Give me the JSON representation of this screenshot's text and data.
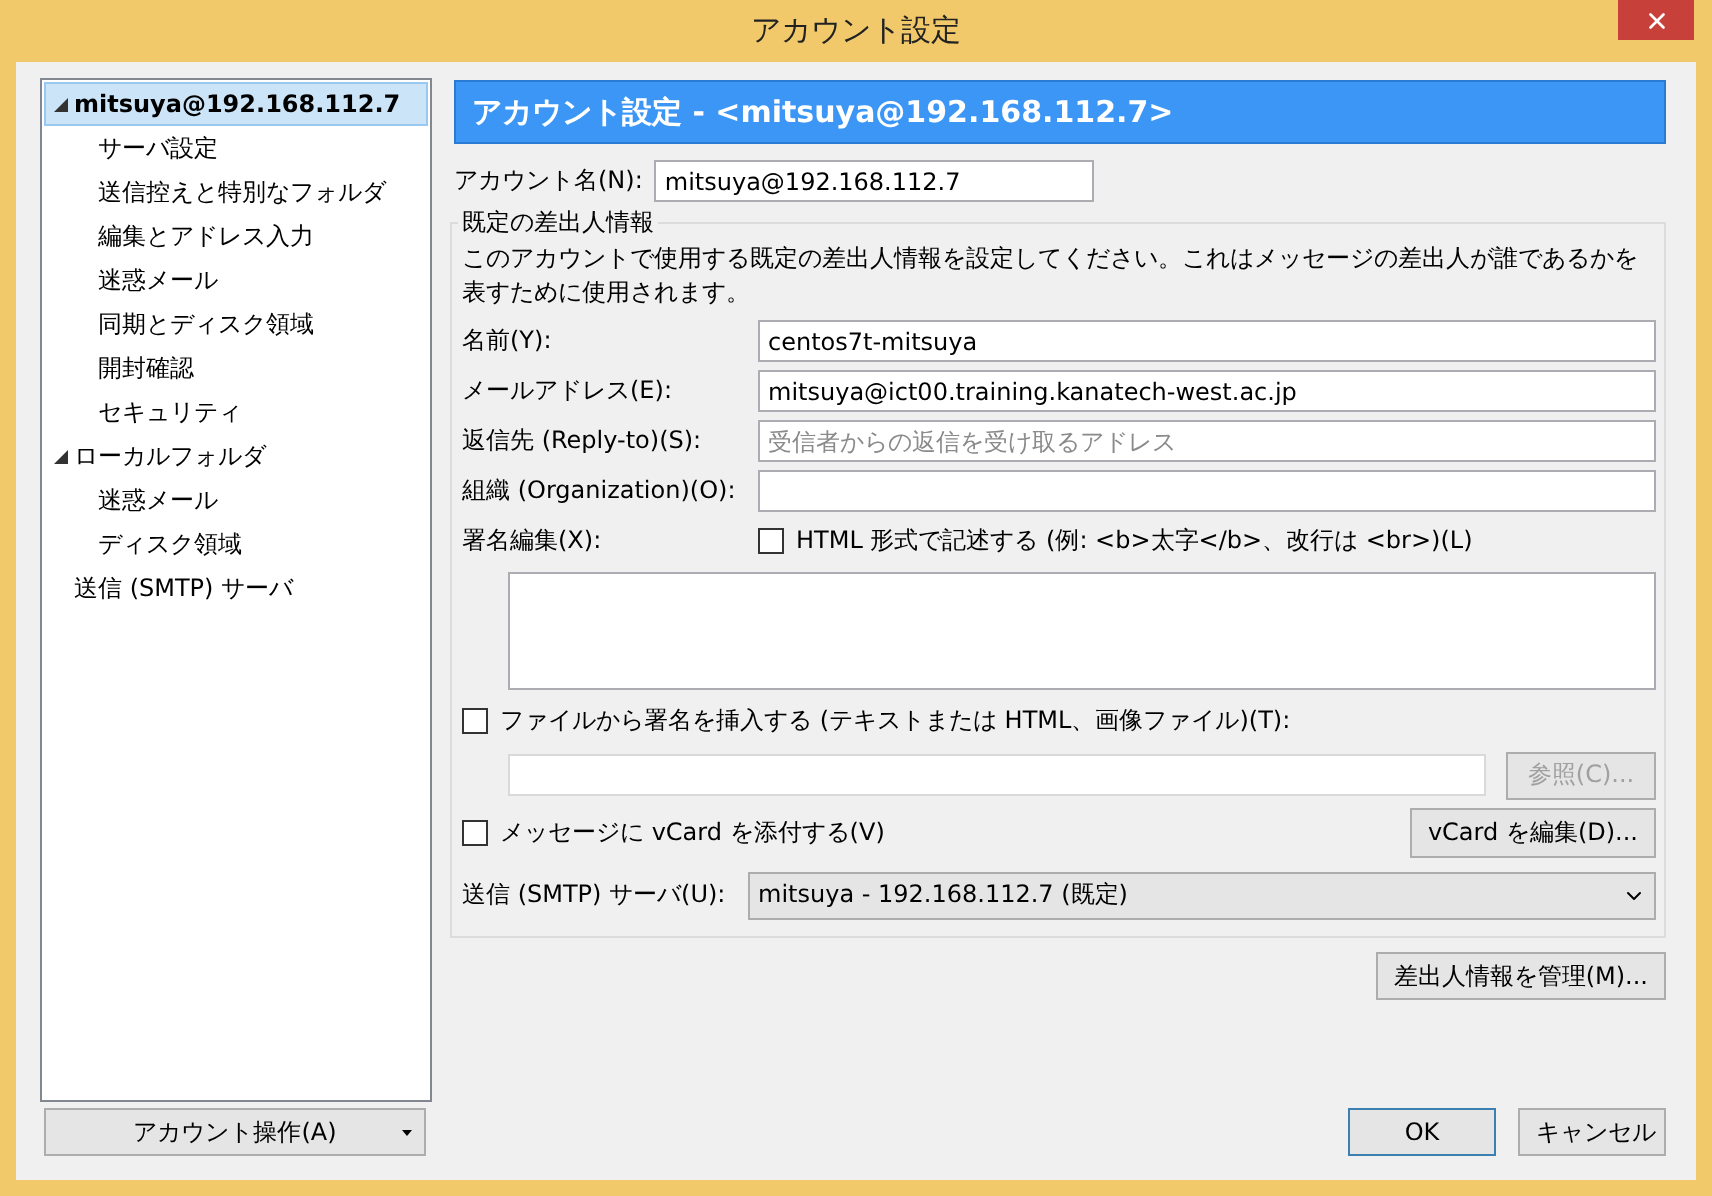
{
  "window": {
    "title": "アカウント設定"
  },
  "tree": [
    {
      "label": "mitsuya@192.168.112.7",
      "selected": true,
      "expanded": true,
      "bold": true,
      "children": [
        {
          "label": "サーバ設定",
          "selected": false
        },
        {
          "label": "送信控えと特別なフォルダ",
          "selected": false
        },
        {
          "label": "編集とアドレス入力",
          "selected": false
        },
        {
          "label": "迷惑メール",
          "selected": false
        },
        {
          "label": "同期とディスク領域",
          "selected": false
        },
        {
          "label": "開封確認",
          "selected": false
        },
        {
          "label": "セキュリティ",
          "selected": false
        }
      ]
    },
    {
      "label": "ローカルフォルダ",
      "selected": false,
      "expanded": true,
      "bold": false,
      "children": [
        {
          "label": "迷惑メール",
          "selected": false
        },
        {
          "label": "ディスク領域",
          "selected": false
        }
      ]
    },
    {
      "label": "送信 (SMTP) サーバ",
      "selected": false,
      "bold": false
    }
  ],
  "account_actions": {
    "label": "アカウント操作(A)"
  },
  "header": "アカウント設定 - <mitsuya@192.168.112.7>",
  "account_name": {
    "label": "アカウント名(N):",
    "value": "mitsuya@192.168.112.7"
  },
  "identity": {
    "legend": "既定の差出人情報",
    "description": "このアカウントで使用する既定の差出人情報を設定してください。これはメッセージの差出人が誰であるかを表すために使用されます。",
    "fields": [
      {
        "label": "名前(Y):",
        "value": "centos7t-mitsuya"
      },
      {
        "label": "メールアドレス(E):",
        "value": "mitsuya@ict00.training.kanatech-west.ac.jp"
      },
      {
        "label": "返信先 (Reply-to)(S):",
        "placeholder": "受信者からの返信を受け取るアドレス"
      },
      {
        "label": "組織 (Organization)(O):"
      }
    ],
    "signature": {
      "label": "署名編集(X):",
      "html_option": {
        "label": "HTML 形式で記述する (例: <b>太字</b>、改行は <br>)(L)",
        "checked": false
      }
    },
    "attach_file": {
      "label": "ファイルから署名を挿入する (テキストまたは HTML、画像ファイル)(T):",
      "checked": false
    },
    "browse_button": {
      "label": "参照(C)...",
      "disabled": true
    },
    "vcard": {
      "label": "メッセージに vCard を添付する(V)",
      "checked": false
    },
    "edit_vcard_button": {
      "label": "vCard を編集(D)..."
    },
    "smtp": {
      "label": "送信 (SMTP) サーバ(U):",
      "value": "mitsuya - 192.168.112.7 (既定)"
    }
  },
  "manage_identities_button": {
    "label": "差出人情報を管理(M)..."
  },
  "buttons": [
    {
      "label": "OK",
      "default": true
    },
    {
      "label": "キャンセル",
      "default": false
    }
  ]
}
